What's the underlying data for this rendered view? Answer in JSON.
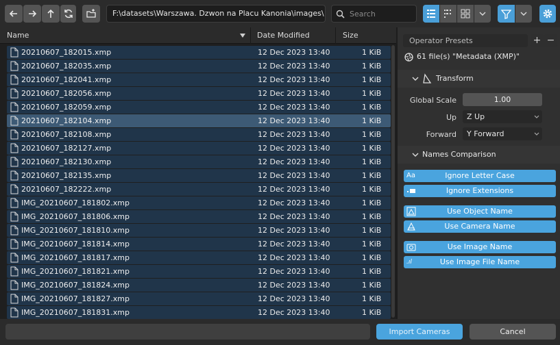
{
  "toolbar": {
    "path": "F:\\datasets\\Warszawa. Dzwon na Placu Kanonia\\images\\",
    "search_placeholder": "Search"
  },
  "columns": {
    "name": "Name",
    "date": "Date Modified",
    "size": "Size"
  },
  "files": [
    {
      "name": "20210607_182015.xmp",
      "date": "12 Dec 2023 13:40",
      "size": "1 KiB"
    },
    {
      "name": "20210607_182035.xmp",
      "date": "12 Dec 2023 13:40",
      "size": "1 KiB"
    },
    {
      "name": "20210607_182041.xmp",
      "date": "12 Dec 2023 13:40",
      "size": "1 KiB"
    },
    {
      "name": "20210607_182056.xmp",
      "date": "12 Dec 2023 13:40",
      "size": "1 KiB"
    },
    {
      "name": "20210607_182059.xmp",
      "date": "12 Dec 2023 13:40",
      "size": "1 KiB"
    },
    {
      "name": "20210607_182104.xmp",
      "date": "12 Dec 2023 13:40",
      "size": "1 KiB"
    },
    {
      "name": "20210607_182108.xmp",
      "date": "12 Dec 2023 13:40",
      "size": "1 KiB"
    },
    {
      "name": "20210607_182127.xmp",
      "date": "12 Dec 2023 13:40",
      "size": "1 KiB"
    },
    {
      "name": "20210607_182130.xmp",
      "date": "12 Dec 2023 13:40",
      "size": "1 KiB"
    },
    {
      "name": "20210607_182135.xmp",
      "date": "12 Dec 2023 13:40",
      "size": "1 KiB"
    },
    {
      "name": "20210607_182222.xmp",
      "date": "12 Dec 2023 13:40",
      "size": "1 KiB"
    },
    {
      "name": "IMG_20210607_181802.xmp",
      "date": "12 Dec 2023 13:40",
      "size": "1 KiB"
    },
    {
      "name": "IMG_20210607_181806.xmp",
      "date": "12 Dec 2023 13:40",
      "size": "1 KiB"
    },
    {
      "name": "IMG_20210607_181810.xmp",
      "date": "12 Dec 2023 13:40",
      "size": "1 KiB"
    },
    {
      "name": "IMG_20210607_181814.xmp",
      "date": "12 Dec 2023 13:40",
      "size": "1 KiB"
    },
    {
      "name": "IMG_20210607_181817.xmp",
      "date": "12 Dec 2023 13:40",
      "size": "1 KiB"
    },
    {
      "name": "IMG_20210607_181821.xmp",
      "date": "12 Dec 2023 13:40",
      "size": "1 KiB"
    },
    {
      "name": "IMG_20210607_181824.xmp",
      "date": "12 Dec 2023 13:40",
      "size": "1 KiB"
    },
    {
      "name": "IMG_20210607_181827.xmp",
      "date": "12 Dec 2023 13:40",
      "size": "1 KiB"
    },
    {
      "name": "IMG_20210607_181831.xmp",
      "date": "12 Dec 2023 13:40",
      "size": "1 KiB"
    }
  ],
  "selected_file": "20210607_182104.xmp",
  "panel": {
    "presets_label": "Operator Presets",
    "file_count": "61 file(s) \"Metadata (XMP)\"",
    "transform": {
      "title": "Transform",
      "global_scale_label": "Global Scale",
      "global_scale_value": "1.00",
      "up_label": "Up",
      "up_value": "Z Up",
      "forward_label": "Forward",
      "forward_value": "Y Forward"
    },
    "names": {
      "title": "Names Comparison",
      "ignore_case": "Ignore Letter Case",
      "ignore_ext": "Ignore Extensions",
      "use_object": "Use Object Name",
      "use_camera": "Use Camera Name",
      "use_image": "Use Image Name",
      "use_image_file": "Use Image File Name"
    }
  },
  "footer": {
    "import_label": "Import Cameras",
    "cancel_label": "Cancel"
  },
  "colors": {
    "accent": "#4aa4de",
    "row_bg": "#20354a",
    "row_selected": "#3d5a75"
  }
}
